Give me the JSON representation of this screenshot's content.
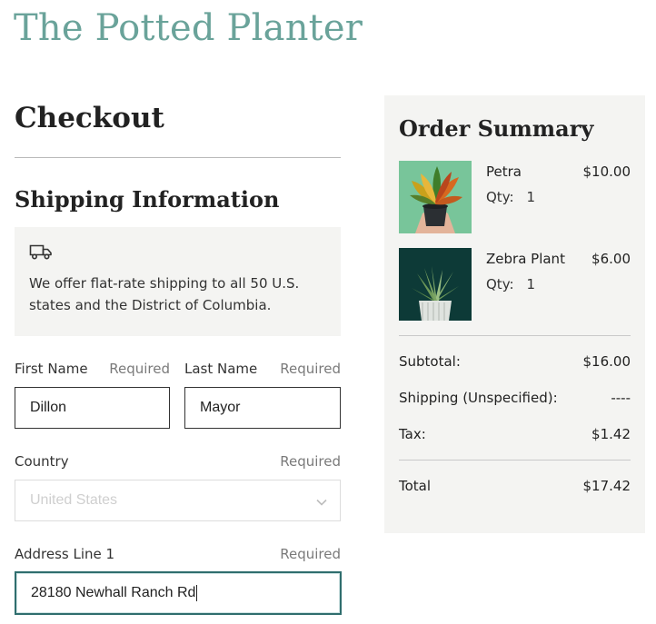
{
  "store": {
    "name": "The Potted Planter"
  },
  "checkout": {
    "title": "Checkout",
    "shipping": {
      "title": "Shipping Information",
      "notice_icon": "truck-icon",
      "notice_text": "We offer flat-rate shipping to all 50 U.S. states and the District of Columbia."
    },
    "fields": {
      "first_name": {
        "label": "First Name",
        "required": "Required",
        "value": "Dillon"
      },
      "last_name": {
        "label": "Last Name",
        "required": "Required",
        "value": "Mayor"
      },
      "country": {
        "label": "Country",
        "required": "Required",
        "placeholder": "United States",
        "icon": "chevron-down-icon"
      },
      "address1": {
        "label": "Address Line 1",
        "required": "Required",
        "value": "28180 Newhall Ranch Rd"
      }
    }
  },
  "summary": {
    "title": "Order Summary",
    "items": [
      {
        "name": "Petra",
        "qty_label": "Qty:",
        "qty": "1",
        "price": "$10.00",
        "image": "croton-plant-photo"
      },
      {
        "name": "Zebra Plant",
        "qty_label": "Qty:",
        "qty": "1",
        "price": "$6.00",
        "image": "zebra-succulent-photo"
      }
    ],
    "subtotal": {
      "label": "Subtotal:",
      "value": "$16.00"
    },
    "shipping": {
      "label": "Shipping (Unspecified):",
      "value": "----"
    },
    "tax": {
      "label": "Tax:",
      "value": "$1.42"
    },
    "total": {
      "label": "Total",
      "value": "$17.42"
    }
  },
  "colors": {
    "brand": "#6aa39a",
    "panel": "#f4f4f2",
    "focus": "#2f6e6e"
  }
}
